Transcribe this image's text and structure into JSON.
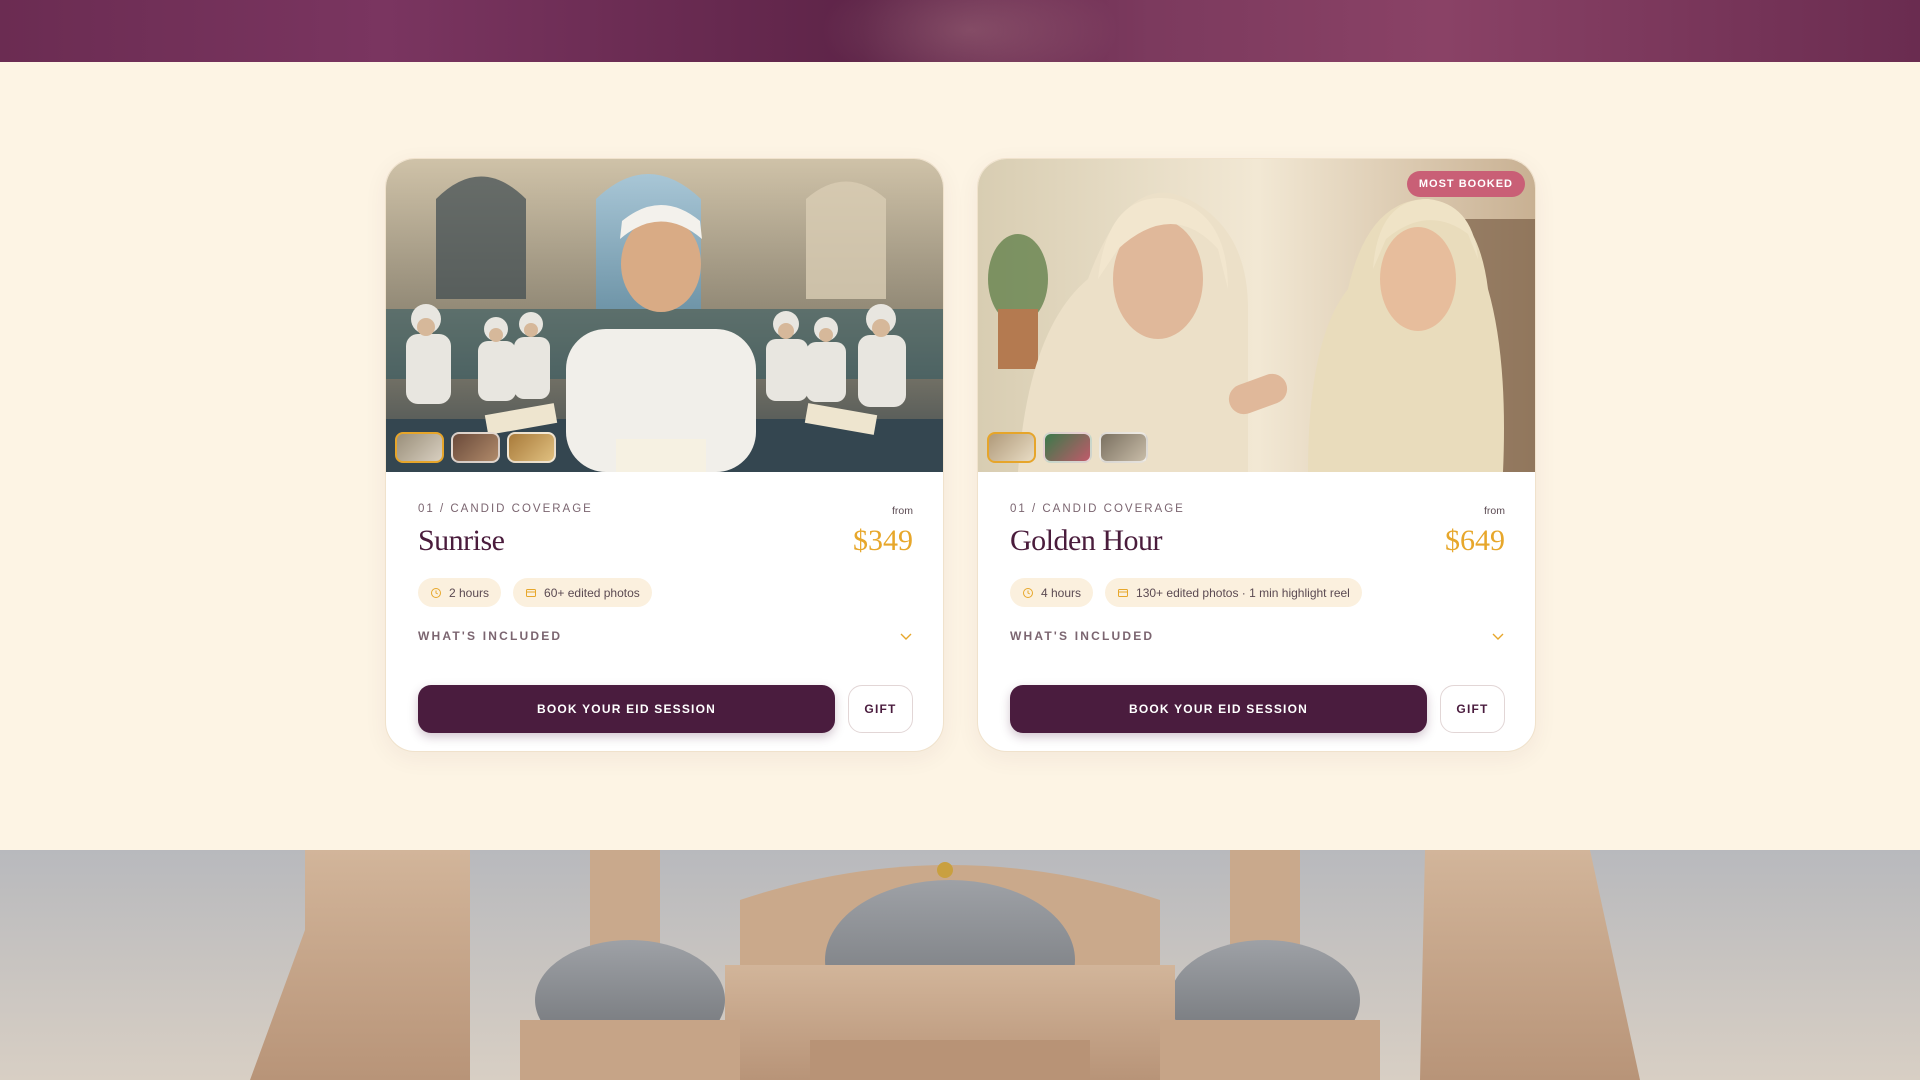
{
  "colors": {
    "background": "#fdf4e4",
    "primary": "#4a1c3e",
    "accent_gold": "#e7a72b",
    "badge_pink": "#c95f76",
    "chip_bg": "#fbf0de"
  },
  "cards": [
    {
      "eyebrow": "01 / CANDID COVERAGE",
      "title": "Sunrise",
      "price_prefix": "from",
      "price": "$349",
      "badge": "",
      "chips": [
        {
          "icon": "clock-icon",
          "label": "2 hours"
        },
        {
          "icon": "photo-icon",
          "label": "60+ edited photos"
        }
      ],
      "included_label": "WHAT'S INCLUDED",
      "book_label": "BOOK YOUR EID SESSION",
      "gift_label": "GIFT",
      "photo_alt": "boys reading in mosque",
      "thumbnails": 3,
      "active_thumbnail": 1
    },
    {
      "eyebrow": "01 / CANDID COVERAGE",
      "title": "Golden Hour",
      "price_prefix": "from",
      "price": "$649",
      "badge": "MOST BOOKED",
      "chips": [
        {
          "icon": "clock-icon",
          "label": "4 hours"
        },
        {
          "icon": "photo-icon",
          "label": "130+ edited photos · 1 min highlight reel"
        }
      ],
      "included_label": "WHAT'S INCLUDED",
      "book_label": "BOOK YOUR EID SESSION",
      "gift_label": "GIFT",
      "photo_alt": "grandmother adjusting granddaughter's headscarf",
      "thumbnails": 3,
      "active_thumbnail": 1
    }
  ]
}
